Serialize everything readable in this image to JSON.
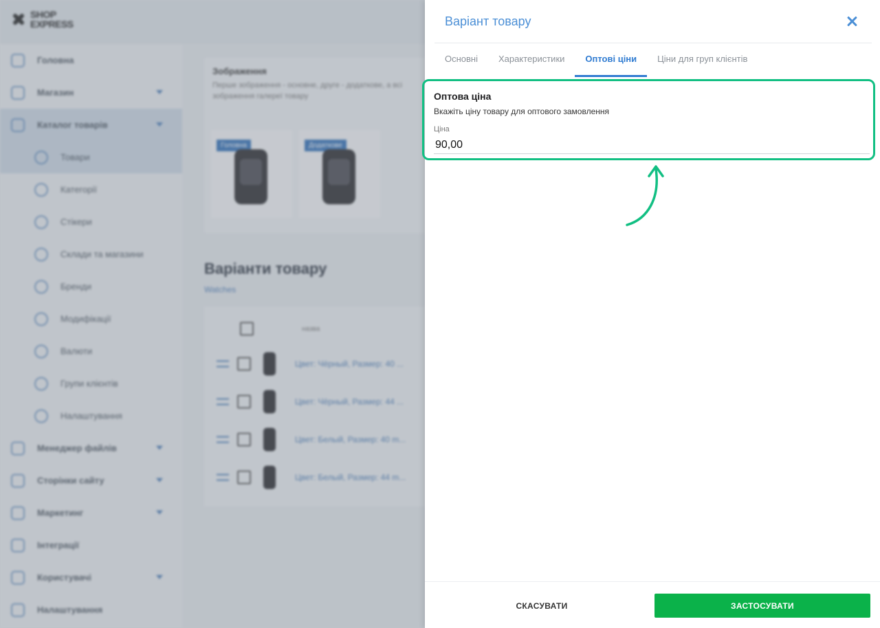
{
  "app": {
    "logo_line1": "SHOP",
    "logo_line2": "EXPRESS"
  },
  "sidebar": {
    "items": [
      {
        "label": "Головна",
        "icon": "home-icon",
        "sub": false,
        "caret": false,
        "active": false
      },
      {
        "label": "Магазин",
        "icon": "cart-icon",
        "sub": false,
        "caret": true,
        "active": false
      },
      {
        "label": "Каталог товарів",
        "icon": "catalog-icon",
        "sub": false,
        "caret": true,
        "active": true
      },
      {
        "label": "Товари",
        "icon": "box-icon",
        "sub": true,
        "caret": false,
        "active": true
      },
      {
        "label": "Категорії",
        "icon": "categories-icon",
        "sub": true,
        "caret": false,
        "active": false
      },
      {
        "label": "Стікери",
        "icon": "sticker-icon",
        "sub": true,
        "caret": false,
        "active": false
      },
      {
        "label": "Склади та магазини",
        "icon": "warehouse-icon",
        "sub": true,
        "caret": false,
        "active": false
      },
      {
        "label": "Бренди",
        "icon": "tag-icon",
        "sub": true,
        "caret": false,
        "active": false
      },
      {
        "label": "Модифікації",
        "icon": "bookmark-icon",
        "sub": true,
        "caret": false,
        "active": false
      },
      {
        "label": "Валюти",
        "icon": "currency-icon",
        "sub": true,
        "caret": false,
        "active": false
      },
      {
        "label": "Групи клієнтів",
        "icon": "user-group-icon",
        "sub": true,
        "caret": false,
        "active": false
      },
      {
        "label": "Налаштування",
        "icon": "gear-icon",
        "sub": true,
        "caret": false,
        "active": false
      },
      {
        "label": "Менеджер файлів",
        "icon": "folder-icon",
        "sub": false,
        "caret": true,
        "active": false
      },
      {
        "label": "Сторінки сайту",
        "icon": "pages-icon",
        "sub": false,
        "caret": true,
        "active": false
      },
      {
        "label": "Маркетинг",
        "icon": "marketing-icon",
        "sub": false,
        "caret": true,
        "active": false
      },
      {
        "label": "Інтеграції",
        "icon": "megaphone-icon",
        "sub": false,
        "caret": false,
        "active": false
      },
      {
        "label": "Користувачі",
        "icon": "user-icon",
        "sub": false,
        "caret": true,
        "active": false
      },
      {
        "label": "Налаштування",
        "icon": "gear-icon",
        "sub": false,
        "caret": false,
        "active": false
      }
    ]
  },
  "main": {
    "images_title": "Зображення",
    "images_desc": "Перше зображення - основне, друге - додаткове, а всі зображення галереї товару",
    "images": [
      {
        "tag": "Головна"
      },
      {
        "tag": "Додаткове"
      }
    ],
    "variants_title": "Варіанти товару",
    "variants_link": "Watches",
    "variants_col_name": "назва",
    "variants": [
      {
        "name": "Цвет: Чёрный, Размер: 40 ..."
      },
      {
        "name": "Цвет: Чёрный, Размер: 44 ..."
      },
      {
        "name": "Цвет: Белый, Размер: 40 m..."
      },
      {
        "name": "Цвет: Белый, Размер: 44 m..."
      }
    ]
  },
  "drawer": {
    "title": "Варіант товару",
    "tabs": [
      {
        "label": "Основні",
        "active": false
      },
      {
        "label": "Характеристики",
        "active": false
      },
      {
        "label": "Оптові ціни",
        "active": true
      },
      {
        "label": "Ціни для груп клієнтів",
        "active": false
      }
    ],
    "wholesale": {
      "title": "Оптова ціна",
      "description": "Вкажіть ціну товару для оптового замовлення",
      "price_label": "Ціна",
      "price_value": "90,00"
    },
    "cancel_label": "СКАСУВАТИ",
    "apply_label": "ЗАСТОСУВАТИ"
  },
  "colors": {
    "accent": "#2f7bd1",
    "highlight": "#12bf83",
    "apply": "#0bb24a"
  }
}
